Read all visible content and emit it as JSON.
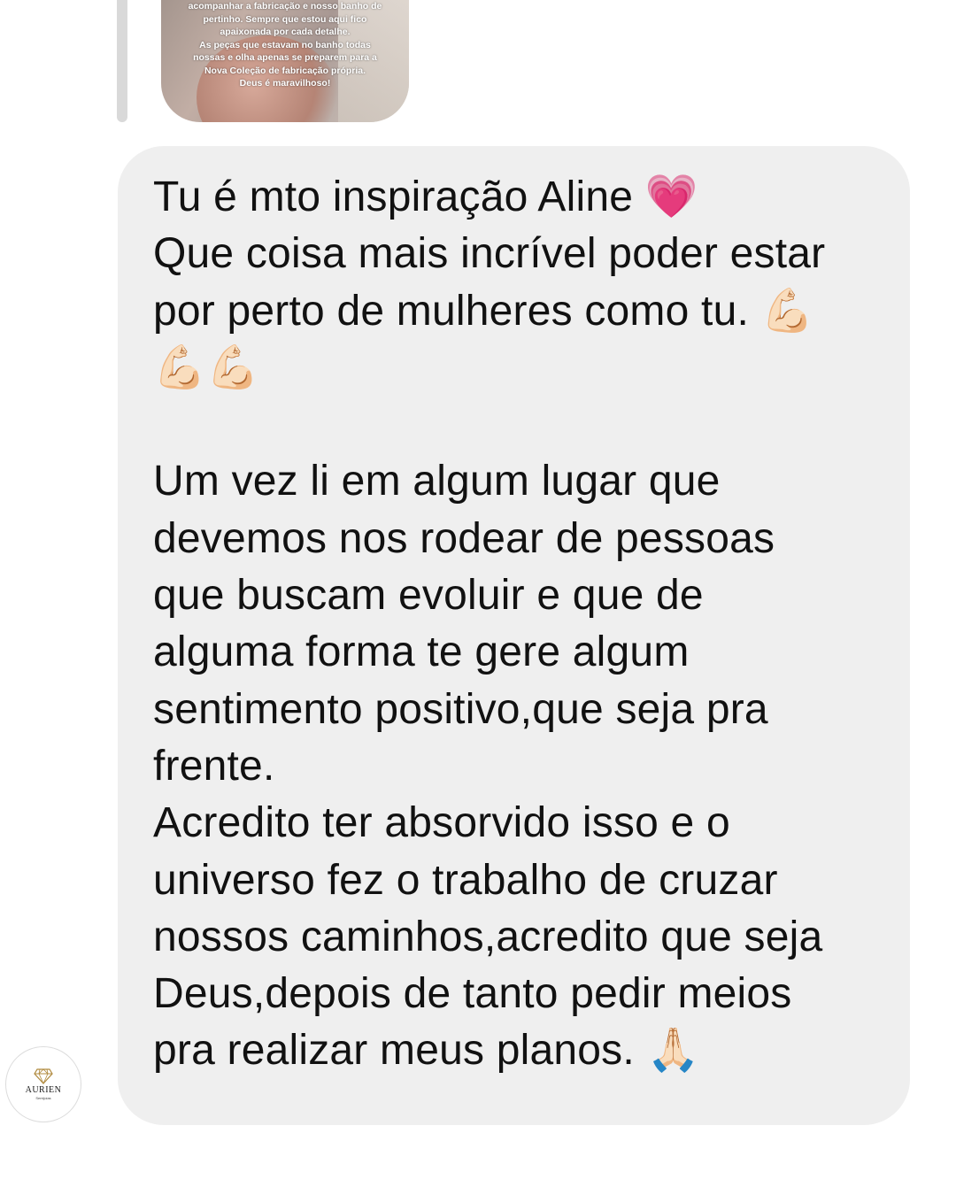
{
  "story_reply": {
    "caption": "acompanhar a fabricação e nosso banho de\npertinho. Sempre que estou aqui fico\napaixonada por cada detalhe.\nAs peças que estavam no banho todas\nnossas e olha apenas se preparem para a\nNova Coleção de fabricação própria.\nDeus é maravilhoso!"
  },
  "message": {
    "text": "Tu é mto inspiração Aline 💗\nQue coisa mais incrível poder estar\npor perto de mulheres como tu. 💪🏻\n💪🏻💪🏻\n\nUm vez li em algum lugar que\ndevemos nos rodear de pessoas\nque buscam evoluir e que de\nalguma forma te gere algum\nsentimento positivo,que seja pra\nfrente.\nAcredito ter absorvido isso e o\nuniverso fez o trabalho de cruzar\nnossos caminhos,acredito que seja\nDeus,depois de tanto pedir meios\npra realizar meus planos. 🙏🏻",
    "bubble_color": "#efefef"
  },
  "sender": {
    "avatar_icon": "diamond-logo-icon",
    "brand_name": "AURIEN",
    "brand_tagline": "Semijoias"
  }
}
